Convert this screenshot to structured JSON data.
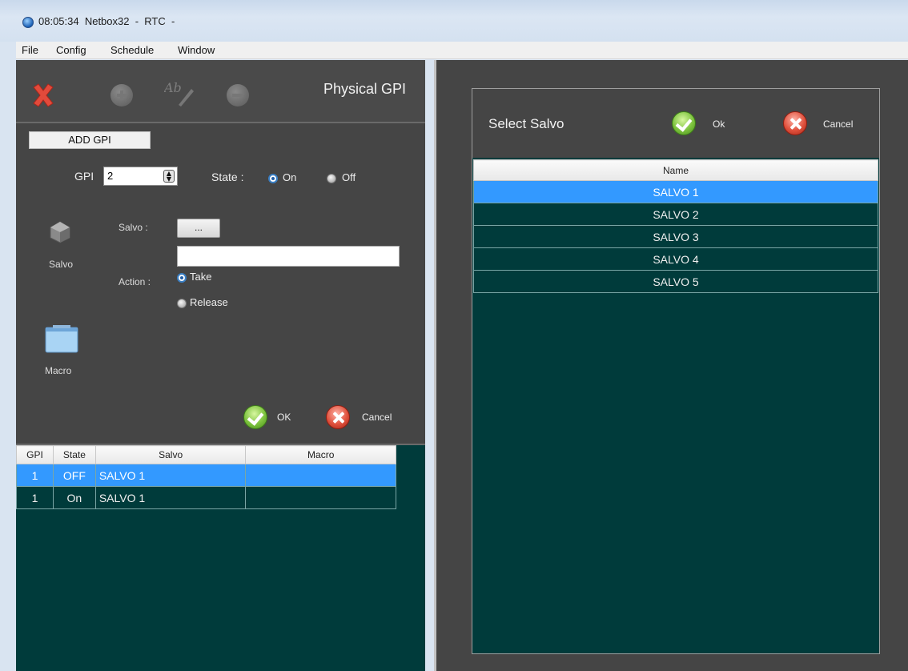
{
  "window": {
    "title": "08:05:34  Netbox32  -  RTC  -"
  },
  "menu": [
    "File",
    "Config",
    "Schedule",
    "Window"
  ],
  "left": {
    "panel_title": "Physical GPI",
    "add_gpi_label": "ADD GPI",
    "gpi_label": "GPI",
    "gpi_value": "2",
    "state_label": "State :",
    "state_on": "On",
    "state_off": "Off",
    "salvo_side_label": "Salvo",
    "salvo_field_label": "Salvo :",
    "salvo_browse": "...",
    "salvo_value": "",
    "action_label": "Action :",
    "action_take": "Take",
    "action_release": "Release",
    "macro_label": "Macro",
    "ok_label": "OK",
    "cancel_label": "Cancel",
    "grid": {
      "columns": [
        "GPI",
        "State",
        "Salvo",
        "Macro"
      ],
      "rows": [
        {
          "gpi": "1",
          "state": "OFF",
          "salvo": "SALVO 1",
          "macro": ""
        },
        {
          "gpi": "1",
          "state": "On",
          "salvo": "SALVO 1",
          "macro": ""
        }
      ]
    }
  },
  "right": {
    "dialog_title": "Select Salvo",
    "ok_label": "Ok",
    "cancel_label": "Cancel",
    "column": "Name",
    "rows": [
      "SALVO 1",
      "SALVO 2",
      "SALVO 3",
      "SALVO 4",
      "SALVO 5"
    ]
  },
  "colors": {
    "selection": "#3399ff",
    "grid_bg": "#003b3b",
    "panel_bg": "#454545"
  }
}
